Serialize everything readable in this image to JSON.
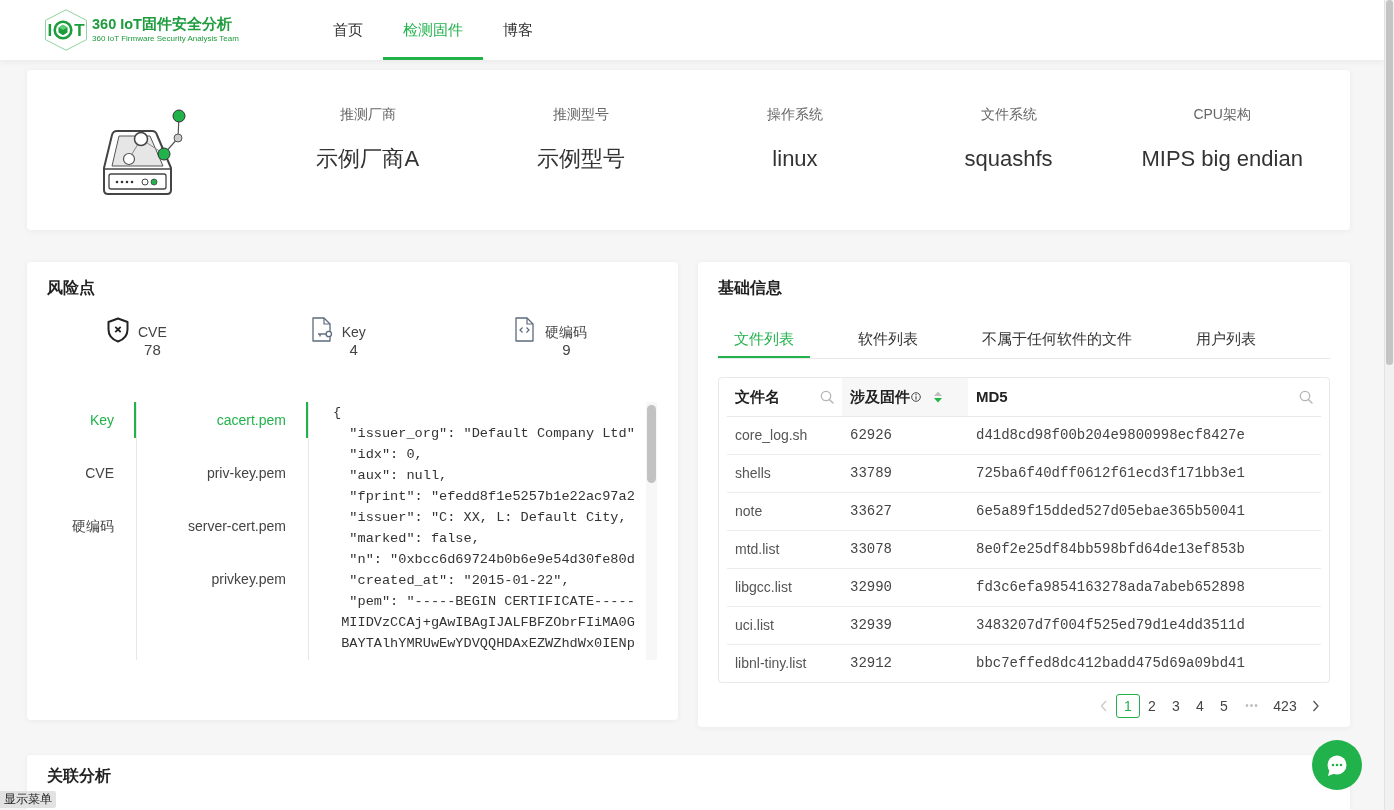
{
  "header": {
    "logo": {
      "letter_left": "I",
      "letter_right": "T",
      "title": "360 IoT固件安全分析",
      "subtitle": "360 IoT Firmware Security Analysis Team"
    },
    "nav": [
      {
        "label": "首页",
        "selected": false
      },
      {
        "label": "检测固件",
        "selected": true
      },
      {
        "label": "博客",
        "selected": false
      }
    ]
  },
  "summary": [
    {
      "label": "推测厂商",
      "value": "示例厂商A"
    },
    {
      "label": "推测型号",
      "value": "示例型号"
    },
    {
      "label": "操作系统",
      "value": "linux"
    },
    {
      "label": "文件系统",
      "value": "squashfs"
    },
    {
      "label": "CPU架构",
      "value": "MIPS big endian"
    }
  ],
  "risk": {
    "title": "风险点",
    "stats": [
      {
        "kind": "cve",
        "label": "CVE",
        "count": "78"
      },
      {
        "kind": "key",
        "label": "Key",
        "count": "4"
      },
      {
        "kind": "hardcode",
        "label": "硬编码",
        "count": "9"
      }
    ],
    "categories": [
      {
        "label": "Key",
        "selected": true
      },
      {
        "label": "CVE",
        "selected": false
      },
      {
        "label": "硬编码",
        "selected": false
      }
    ],
    "files": [
      {
        "label": "cacert.pem",
        "selected": true
      },
      {
        "label": "priv-key.pem",
        "selected": false
      },
      {
        "label": "server-cert.pem",
        "selected": false
      },
      {
        "label": "privkey.pem",
        "selected": false
      }
    ],
    "code": "{\n  \"issuer_org\": \"Default Company Ltd\"\n  \"idx\": 0,\n  \"aux\": null,\n  \"fprint\": \"efedd8f1e5257b1e22ac97a2\n  \"issuer\": \"C: XX, L: Default City,\n  \"marked\": false,\n  \"n\": \"0xbcc6d69724b0b6e9e54d30fe80d\n  \"created_at\": \"2015-01-22\",\n  \"pem\": \"-----BEGIN CERTIFICATE-----\n MIIDVzCCAj+gAwIBAgIJALFBFZObrFIiMA0G\n BAYTAlhYMRUwEwYDVQQHDAxEZWZhdWx0IENp"
  },
  "basic_info": {
    "title": "基础信息",
    "tabs": [
      {
        "label": "文件列表",
        "selected": true
      },
      {
        "label": "软件列表",
        "selected": false
      },
      {
        "label": "不属于任何软件的文件",
        "selected": false
      },
      {
        "label": "用户列表",
        "selected": false
      }
    ],
    "table": {
      "columns": [
        {
          "label": "文件名",
          "search": true,
          "info": false,
          "sortable": false,
          "sorted_descending": false
        },
        {
          "label": "涉及固件",
          "search": false,
          "info": true,
          "sortable": true,
          "sorted_descending": true
        },
        {
          "label": "MD5",
          "search": true,
          "info": false,
          "sortable": false,
          "sorted_descending": false
        }
      ],
      "rows": [
        {
          "cells": [
            "core_log.sh",
            "62926",
            "d41d8cd98f00b204e9800998ecf8427e"
          ]
        },
        {
          "cells": [
            "shells",
            "33789",
            "725ba6f40dff0612f61ecd3f171bb3e1"
          ]
        },
        {
          "cells": [
            "note",
            "33627",
            "6e5a89f15dded527d05ebae365b50041"
          ]
        },
        {
          "cells": [
            "mtd.list",
            "33078",
            "8e0f2e25df84bb598bfd64de13ef853b"
          ]
        },
        {
          "cells": [
            "libgcc.list",
            "32990",
            "fd3c6efa9854163278ada7abeb652898"
          ]
        },
        {
          "cells": [
            "uci.list",
            "32939",
            "3483207d7f004f525ed79d1e4dd3511d"
          ]
        },
        {
          "cells": [
            "libnl-tiny.list",
            "32912",
            "bbc7effed8dc412badd475d69a09bd41"
          ]
        }
      ]
    },
    "pagination": {
      "previous": {
        "disabled": true
      },
      "next": {
        "disabled": false
      },
      "pages": [
        {
          "kind": "page",
          "label": "1",
          "selected": true
        },
        {
          "kind": "page",
          "label": "2",
          "selected": false
        },
        {
          "kind": "page",
          "label": "3",
          "selected": false
        },
        {
          "kind": "page",
          "label": "4",
          "selected": false
        },
        {
          "kind": "page",
          "label": "5",
          "selected": false
        },
        {
          "kind": "ellipsis",
          "label": "•••",
          "selected": false
        },
        {
          "kind": "page",
          "label": "423",
          "selected": false
        }
      ]
    }
  },
  "related": {
    "title": "关联分析"
  },
  "menu_toggle": {
    "label": "显示菜单"
  }
}
